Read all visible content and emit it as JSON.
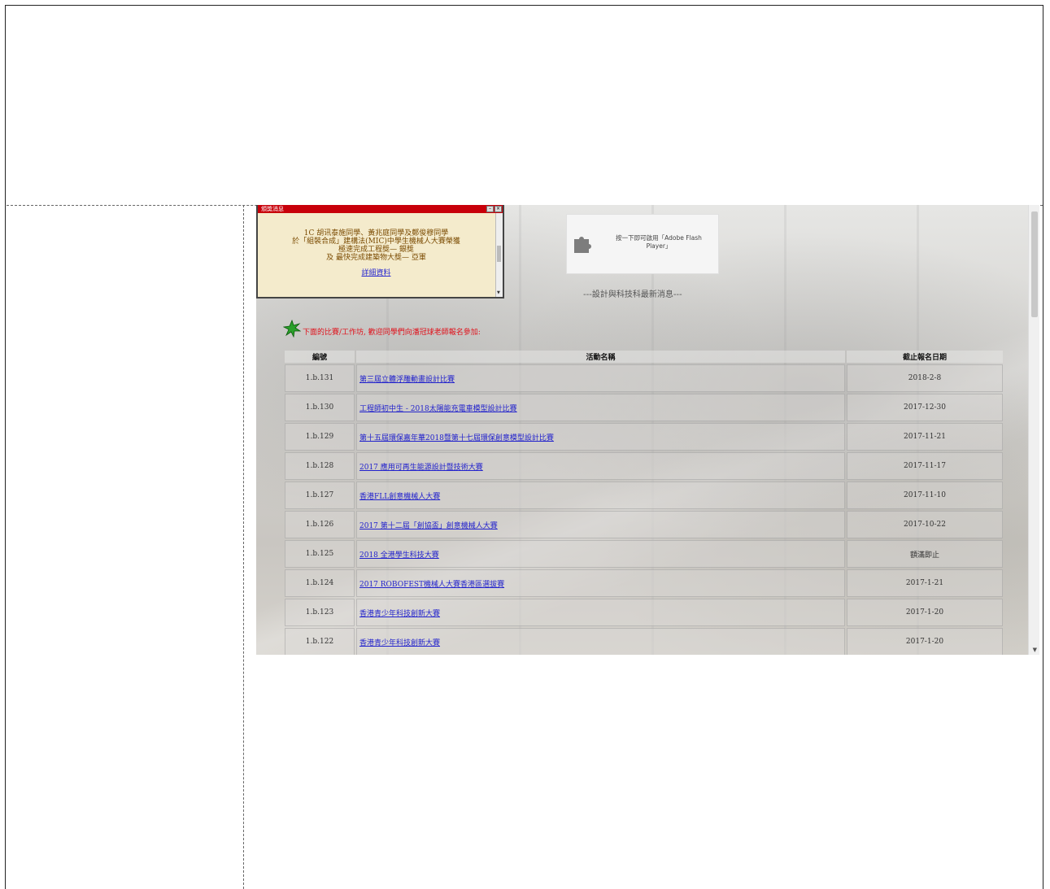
{
  "popup": {
    "title": "頒獎消息",
    "lines": [
      "1C 胡讯泰施同學、黃兆庭同學及鄭俊穆同學",
      "於「組裝合成」建構法(MIC)中學生機械人大賽榮獲",
      "極速完成工程獎— 銀獎",
      "及 最快完成建築物大獎— 亞軍"
    ],
    "link": "詳細資料"
  },
  "flash": {
    "line1": "按一下即可啟用「Adobe Flash",
    "line2": "Player」"
  },
  "latest_heading": "---設計與科技科最新消息---",
  "notice": "下面的比賽/工作坊, 歡迎同學們向潘冠球老師報名參加:",
  "table": {
    "headers": [
      "編號",
      "活動名稱",
      "截止報名日期"
    ],
    "rows": [
      {
        "id": "1.b.131",
        "name": "第三屆立體浮雕動畫設計比賽",
        "deadline": "2018-2-8"
      },
      {
        "id": "1.b.130",
        "name": "工程師初中生 - 2018太陽能充電車模型設計比賽",
        "deadline": "2017-12-30"
      },
      {
        "id": "1.b.129",
        "name": "第十五屆環保嘉年華2018暨第十七屆環保創意模型設計比賽",
        "deadline": "2017-11-21"
      },
      {
        "id": "1.b.128",
        "name": "2017 應用可再生能源設計暨技術大賽",
        "deadline": "2017-11-17"
      },
      {
        "id": "1.b.127",
        "name": "香港FLL創意機械人大賽",
        "deadline": "2017-11-10"
      },
      {
        "id": "1.b.126",
        "name": "2017 第十二屆「創協盃」創意機械人大賽",
        "deadline": "2017-10-22"
      },
      {
        "id": "1.b.125",
        "name": "2018 全港學生科技大賽",
        "deadline": "額滿即止"
      },
      {
        "id": "1.b.124",
        "name": "2017 ROBOFEST機械人大賽香港區選拔賽",
        "deadline": "2017-1-21"
      },
      {
        "id": "1.b.123",
        "name": "香港青少年科技創新大賽",
        "deadline": "2017-1-20"
      },
      {
        "id": "1.b.122",
        "name": "香港青少年科技創新大賽",
        "deadline": "2017-1-20"
      }
    ]
  }
}
